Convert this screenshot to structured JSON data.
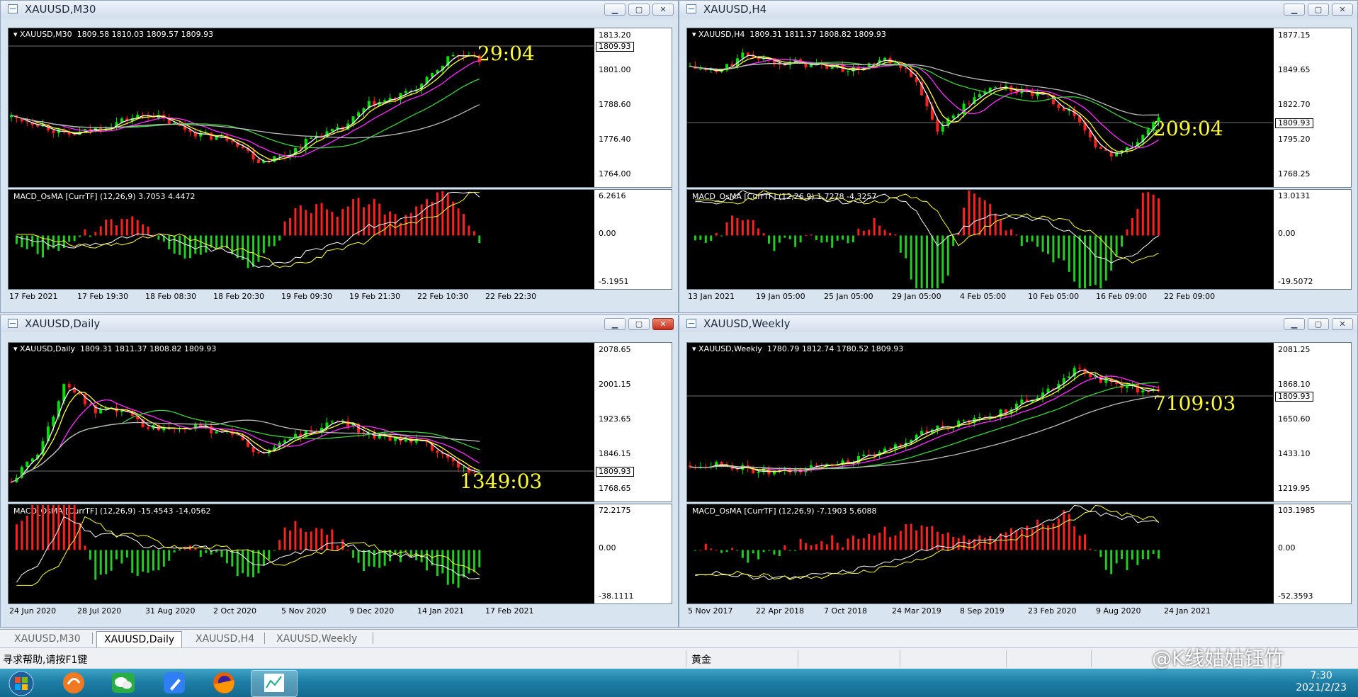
{
  "windows": [
    {
      "title": "XAUUSD,M30",
      "info": "XAUUSD,M30  1809.58 1810.03 1809.57 1809.93",
      "timer": "29:04",
      "price_scale": [
        "1813.20",
        "1801.00",
        "1788.60",
        "1776.40",
        "1764.00"
      ],
      "current_price": "1809.93",
      "macd_info": "MACD_OsMA [CurrTF] (12,26,9) 3.7053 4.4472",
      "macd_scale": [
        "6.2616",
        "0.00",
        "-5.1951"
      ],
      "time_labels": [
        "17 Feb 2021",
        "17 Feb 19:30",
        "18 Feb 08:30",
        "18 Feb 20:30",
        "19 Feb 09:30",
        "19 Feb 21:30",
        "22 Feb 10:30",
        "22 Feb 22:30"
      ]
    },
    {
      "title": "XAUUSD,H4",
      "info": "XAUUSD,H4  1809.31 1811.37 1808.82 1809.93",
      "timer": "209:04",
      "price_scale": [
        "1877.15",
        "1849.65",
        "1822.70",
        "1795.20",
        "1768.25"
      ],
      "current_price": "1809.93",
      "macd_info": "MACD_OsMA [CurrTF] (12,26,9) 1.7278 -4.3257",
      "macd_scale": [
        "13.0131",
        "0.00",
        "-19.5072"
      ],
      "time_labels": [
        "13 Jan 2021",
        "19 Jan 05:00",
        "25 Jan 05:00",
        "29 Jan 05:00",
        "4 Feb 05:00",
        "10 Feb 05:00",
        "16 Feb 09:00",
        "22 Feb 09:00"
      ]
    },
    {
      "title": "XAUUSD,Daily",
      "info": "XAUUSD,Daily  1809.31 1811.37 1808.82 1809.93",
      "timer": "1349:03",
      "price_scale": [
        "2078.65",
        "2001.15",
        "1923.65",
        "1846.15",
        "1768.65"
      ],
      "current_price": "1809.93",
      "macd_info": "MACD_OsMA [CurrTF] (12,26,9) -15.4543 -14.0562",
      "macd_scale": [
        "72.2175",
        "0.00",
        "-38.1111"
      ],
      "time_labels": [
        "24 Jun 2020",
        "28 Jul 2020",
        "31 Aug 2020",
        "2 Oct 2020",
        "5 Nov 2020",
        "9 Dec 2020",
        "14 Jan 2021",
        "17 Feb 2021"
      ]
    },
    {
      "title": "XAUUSD,Weekly",
      "info": "XAUUSD,Weekly  1780.79 1812.74 1780.52 1809.93",
      "timer": "7109:03",
      "price_scale": [
        "2081.25",
        "1868.10",
        "1650.60",
        "1433.10",
        "1219.95"
      ],
      "current_price": "1809.93",
      "macd_info": "MACD_OsMA [CurrTF] (12,26,9) -7.1903 5.6088",
      "macd_scale": [
        "103.1985",
        "0.00",
        "-52.3593"
      ],
      "time_labels": [
        "5 Nov 2017",
        "22 Apr 2018",
        "7 Oct 2018",
        "24 Mar 2019",
        "8 Sep 2019",
        "23 Feb 2020",
        "9 Aug 2020",
        "24 Jan 2021"
      ]
    }
  ],
  "tabs": [
    "XAUUSD,M30",
    "XAUUSD,Daily",
    "XAUUSD,H4",
    "XAUUSD,Weekly"
  ],
  "active_tab": "XAUUSD,Daily",
  "status": {
    "help": "寻求帮助,请按F1键",
    "symbol_name": "黄金"
  },
  "watermark": "@K线姑姑钰竹",
  "clock": {
    "time": "7:30",
    "date": "2021/2/23"
  },
  "colors": {
    "bull": "#00e000",
    "bear": "#ff2020",
    "ma_fast": "#ffffff",
    "ma_yellow": "#ffff40",
    "ma_magenta": "#ff30ff",
    "ma_green": "#40d040",
    "ma_gray": "#bbbbbb",
    "timer": "#ffff33",
    "hist_up": "#ff2020",
    "hist_down": "#22cc22"
  }
}
